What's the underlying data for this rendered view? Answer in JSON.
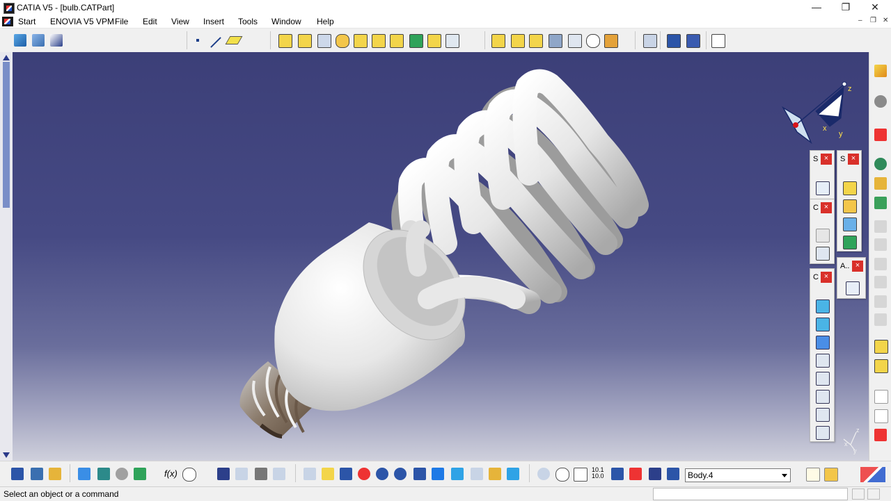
{
  "window": {
    "title": "CATIA V5 - [bulb.CATPart]",
    "controls": {
      "minimize": "—",
      "maximize": "❐",
      "close": "✕"
    }
  },
  "menubar": {
    "items": [
      "Start",
      "ENOVIA V5 VPM",
      "File",
      "Edit",
      "View",
      "Insert",
      "Tools",
      "Window",
      "Help"
    ],
    "doc_controls": {
      "minimize": "–",
      "restore": "❐",
      "close": "✕"
    }
  },
  "palettes": [
    {
      "id": "palette-sketch",
      "label": "S",
      "close": "×"
    },
    {
      "id": "palette-solids",
      "label": "S",
      "close": "×"
    },
    {
      "id": "palette-constraints",
      "label": "C",
      "close": "×"
    },
    {
      "id": "palette-analysis",
      "label": "A..",
      "close": "×"
    },
    {
      "id": "palette-views",
      "label": "C",
      "close": "×"
    }
  ],
  "compass": {
    "x": "x",
    "y": "y",
    "z": "z"
  },
  "mini_axis": {
    "x": "x",
    "y": "y",
    "z": "z"
  },
  "bottom_toolbar": {
    "current_body": "Body.4",
    "formula_label": "f(x)",
    "scale_label": "10.1\n10.0"
  },
  "status": {
    "message": "Select an object or a command",
    "input_value": ""
  },
  "colors": {
    "viewport_top": "#3c3f78",
    "viewport_bottom": "#cfd0dc",
    "bulb_white": "#eeeeee",
    "base_metal": "#6b5a4a",
    "close_red": "#d9302a"
  }
}
